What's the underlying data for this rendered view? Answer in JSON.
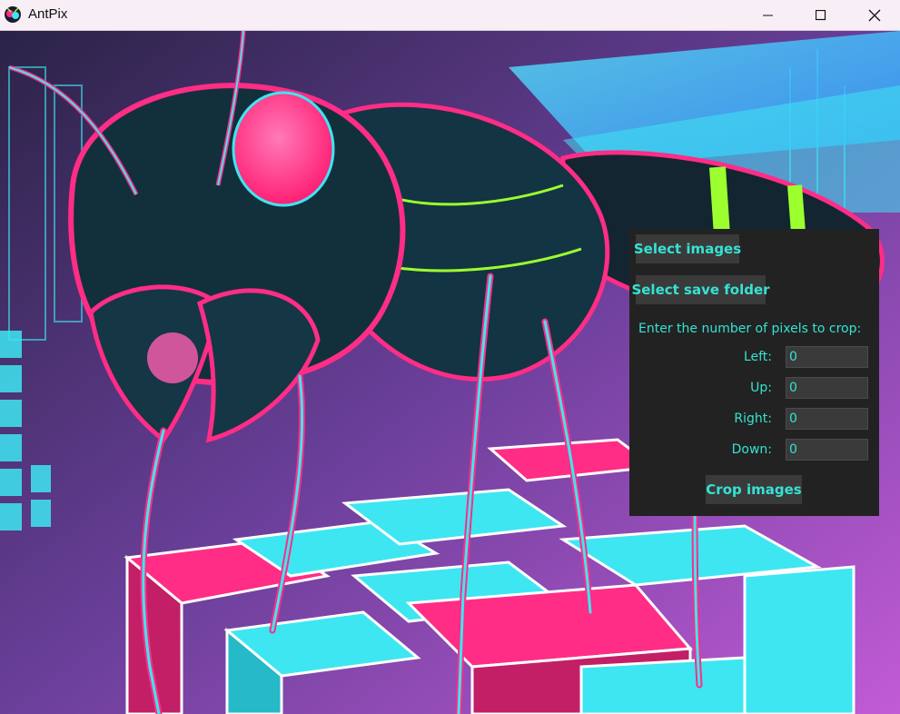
{
  "window": {
    "title": "AntPix",
    "controls": [
      "minimize-icon",
      "maximize-icon",
      "close-icon"
    ]
  },
  "panel": {
    "select_images_label": "Select images",
    "select_folder_label": "Select save folder",
    "prompt": "Enter the number of pixels to crop:",
    "fields": [
      {
        "label": "Left:",
        "value": "0"
      },
      {
        "label": "Up:",
        "value": "0"
      },
      {
        "label": "Right:",
        "value": "0"
      },
      {
        "label": "Down:",
        "value": "0"
      }
    ],
    "crop_label": "Crop images"
  },
  "colors": {
    "accent_text": "#35e3d3",
    "panel_bg": "#222222",
    "button_bg": "#3a3a3a",
    "neon_pink": "#ff2d86",
    "neon_cyan": "#3ee6f2",
    "neon_lime": "#9cff2e"
  }
}
